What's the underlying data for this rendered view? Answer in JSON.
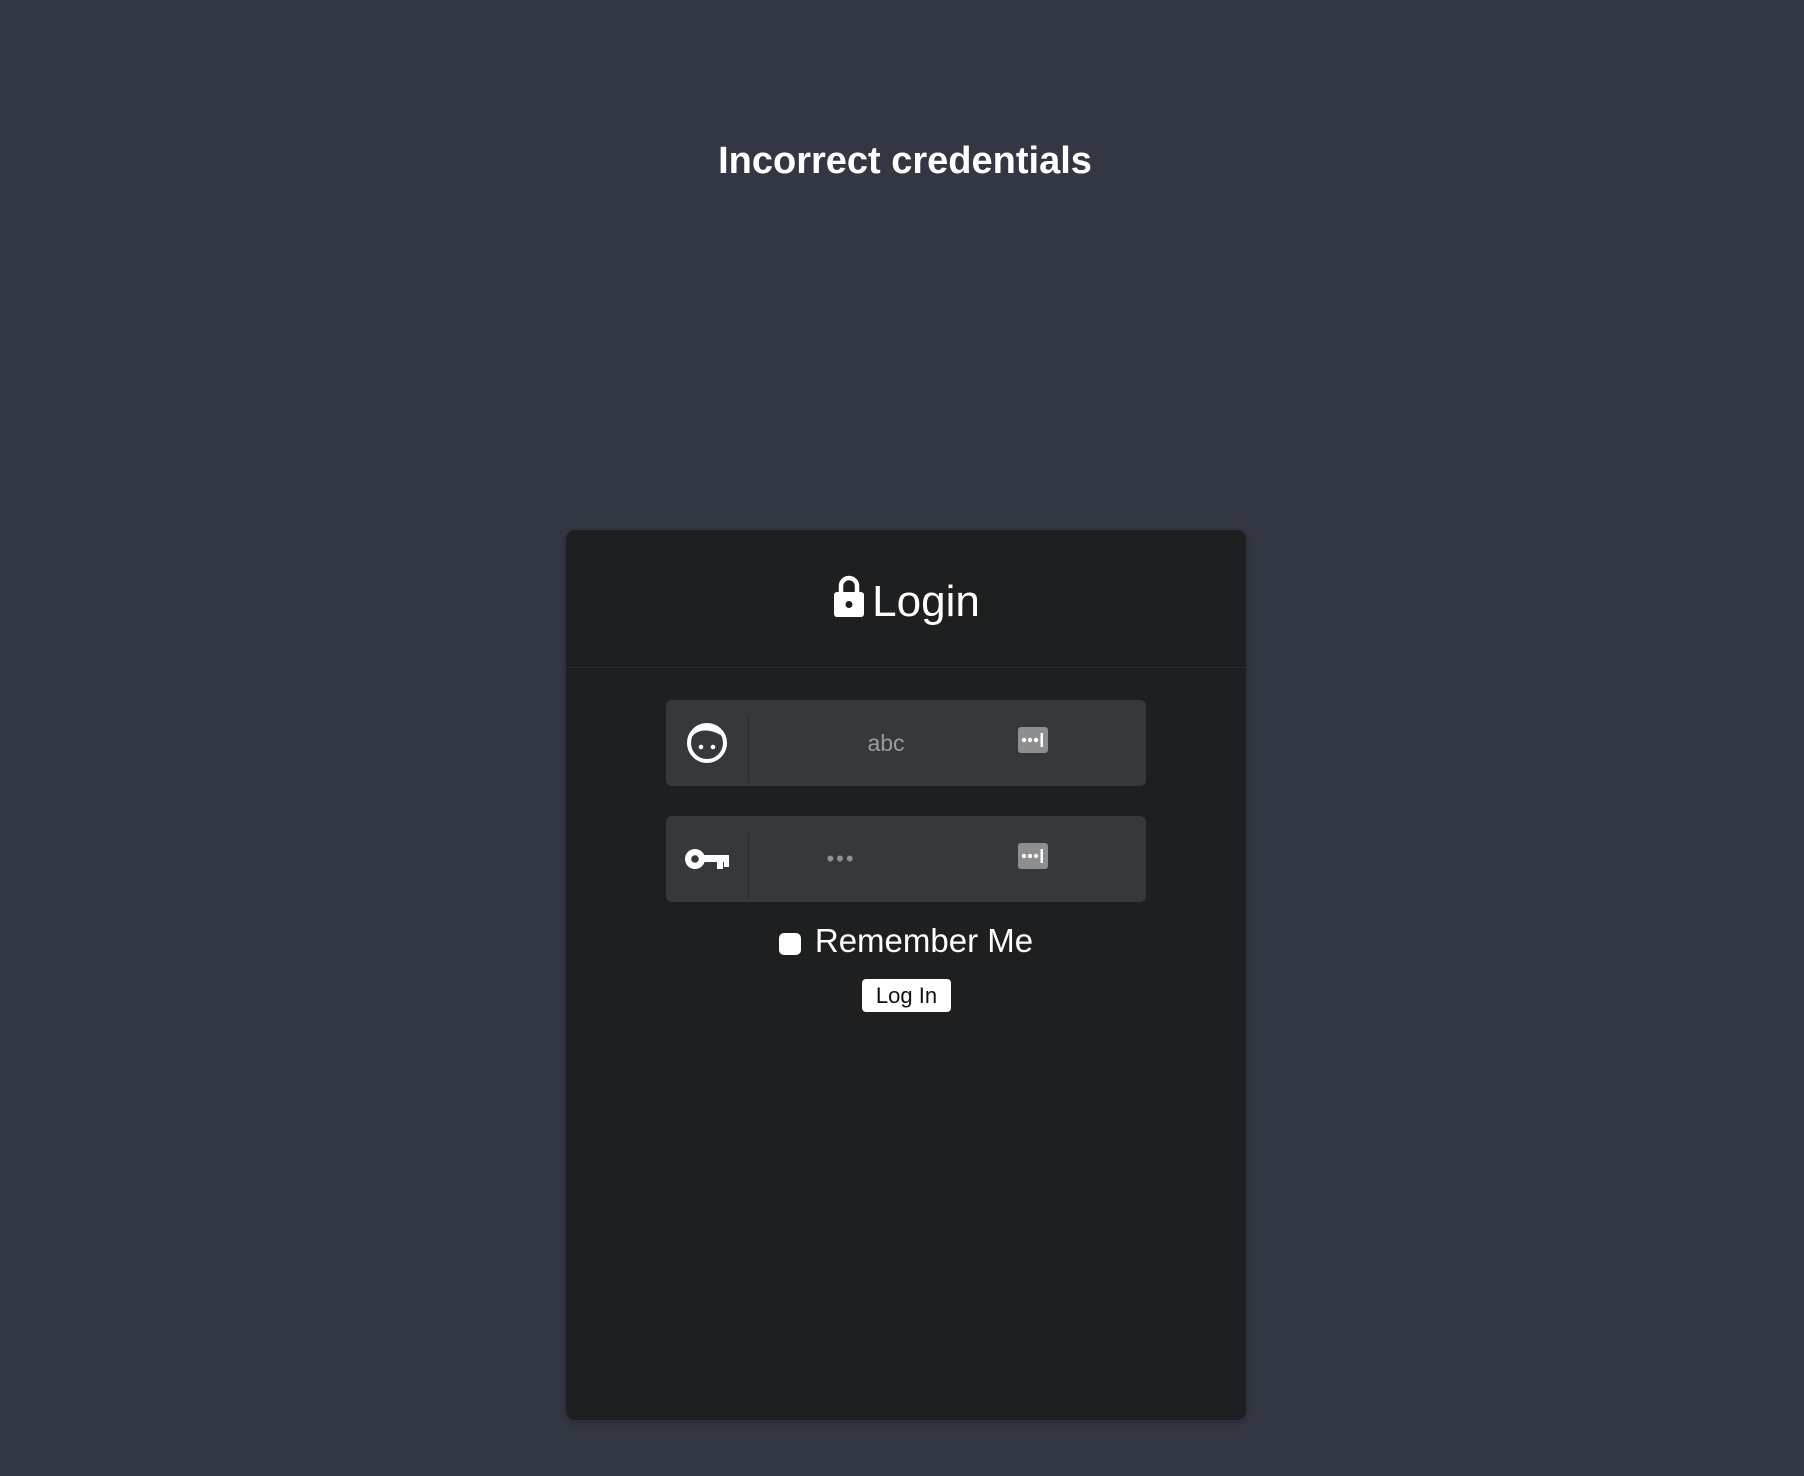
{
  "error_message": "Incorrect credentials",
  "login_card": {
    "title": "Login",
    "icons": {
      "header": "lock-icon",
      "username": "face-icon",
      "password": "key-icon",
      "password_manager": "password-manager-icon"
    },
    "username": {
      "value": "abc",
      "placeholder": ""
    },
    "password": {
      "masked_value": "•••"
    },
    "remember_me": {
      "label": "Remember Me",
      "checked": false
    },
    "submit_label": "Log In"
  },
  "colors": {
    "page_background": "#333743",
    "card_background": "#1e1f21",
    "field_background": "#36393b",
    "text": "#ffffff"
  }
}
